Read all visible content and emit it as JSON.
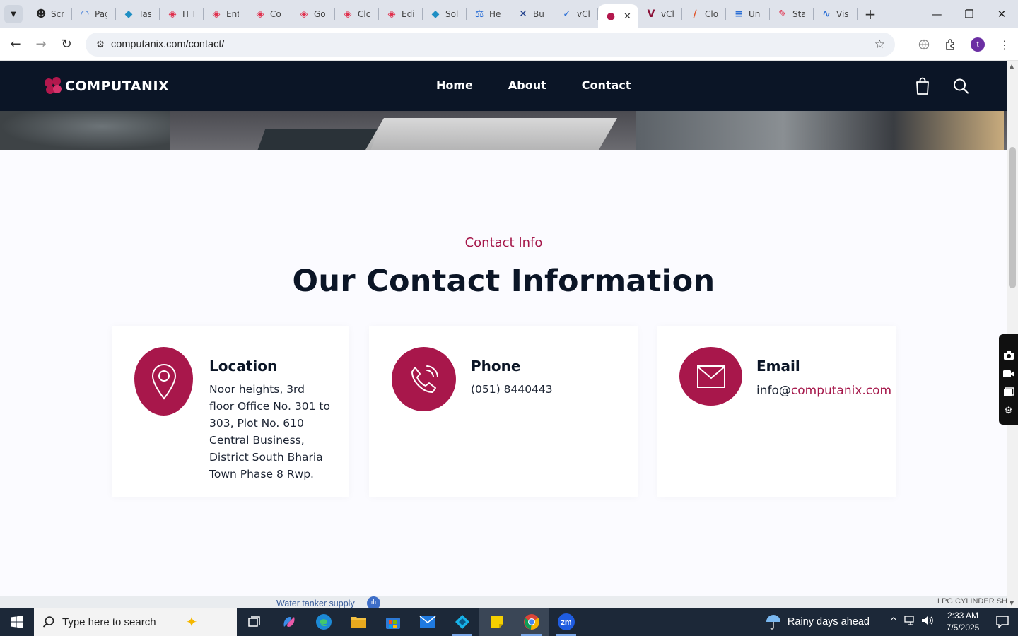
{
  "browser": {
    "tabs": [
      {
        "title": "Scr",
        "color": "#222222",
        "glyph": "☻",
        "icon": "cutout-icon"
      },
      {
        "title": "Pag",
        "color": "#2b6fd6",
        "glyph": "◠",
        "icon": "pagespeed-icon"
      },
      {
        "title": "Tas",
        "color": "#1f8fc4",
        "glyph": "◆",
        "icon": "task-icon"
      },
      {
        "title": "IT I",
        "color": "#e0304d",
        "glyph": "◈",
        "icon": "diamond-icon"
      },
      {
        "title": "Ent",
        "color": "#e0304d",
        "glyph": "◈",
        "icon": "diamond-icon"
      },
      {
        "title": "Co",
        "color": "#e0304d",
        "glyph": "◈",
        "icon": "diamond-icon"
      },
      {
        "title": "Go",
        "color": "#e0304d",
        "glyph": "◈",
        "icon": "diamond-icon"
      },
      {
        "title": "Clo",
        "color": "#e0304d",
        "glyph": "◈",
        "icon": "diamond-icon"
      },
      {
        "title": "Edi",
        "color": "#e0304d",
        "glyph": "◈",
        "icon": "diamond-icon"
      },
      {
        "title": "Sol",
        "color": "#1f8fc4",
        "glyph": "◆",
        "icon": "hexagon-icon"
      },
      {
        "title": "He",
        "color": "#2b6fd6",
        "glyph": "⚖",
        "icon": "scale-icon"
      },
      {
        "title": "Bu",
        "color": "#1b3c8a",
        "glyph": "✕",
        "icon": "x-logo-icon"
      },
      {
        "title": "vCl",
        "color": "#2b6fd6",
        "glyph": "✓",
        "icon": "check-icon"
      },
      {
        "title": "",
        "color": "#b3184d",
        "glyph": "●",
        "icon": "computanix-favicon-icon",
        "active": true
      },
      {
        "title": "vCl",
        "color": "#8a1037",
        "glyph": "V",
        "icon": "v-logo-icon"
      },
      {
        "title": "Clo",
        "color": "#e0552b",
        "glyph": "∕",
        "icon": "slash-icon"
      },
      {
        "title": "Un",
        "color": "#2b6fd6",
        "glyph": "≡",
        "icon": "docs-icon"
      },
      {
        "title": "Sta",
        "color": "#e0304d",
        "glyph": "✎",
        "icon": "pen-icon"
      },
      {
        "title": "Vis",
        "color": "#2b6fd6",
        "glyph": "∿",
        "icon": "pulse-icon"
      }
    ],
    "url": "computanix.com/contact/"
  },
  "site": {
    "brand": "COMPUTANIX",
    "nav": {
      "home": "Home",
      "about": "About",
      "contact": "Contact"
    },
    "section_subtitle": "Contact Info",
    "section_title": "Our Contact Information",
    "cards": {
      "location": {
        "title": "Location",
        "lines": [
          "Noor heights, 3rd",
          "floor Office No. 301 to",
          "303, Plot No. 610",
          "Central Business,",
          "District South Bharia",
          "Town Phase 8 Rwp."
        ]
      },
      "phone": {
        "title": "Phone",
        "value": "(051) 8440443"
      },
      "email": {
        "title": "Email",
        "prefix": "info@",
        "domain": "computanix.com"
      }
    },
    "accent_color": "#a8174b",
    "nav_bg": "#0b1526"
  },
  "map_strip": {
    "label": "Water tanker supply",
    "corner_label": "LPG CYLINDER SH"
  },
  "taskbar": {
    "search_placeholder": "Type here to search",
    "weather": "Rainy days ahead",
    "time": "2:33 AM",
    "date": "7/5/2025"
  }
}
